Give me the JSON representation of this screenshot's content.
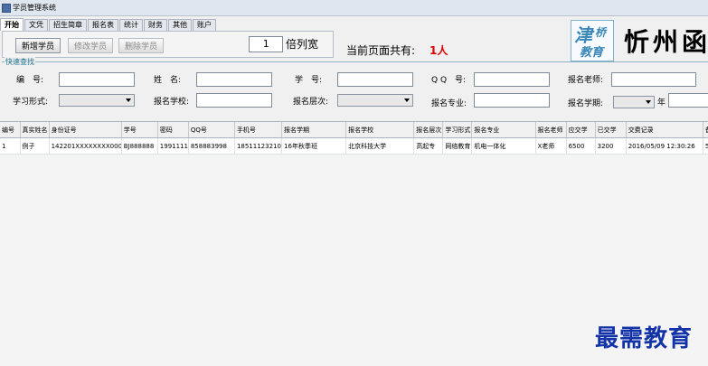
{
  "window": {
    "title": "学员管理系统",
    "icon": "app-icon"
  },
  "tabs": [
    "开始",
    "文凭",
    "招生简章",
    "报名表",
    "统计",
    "财务",
    "其他",
    "账户"
  ],
  "toolbar": {
    "add_label": "新增学员",
    "edit_label": "修改学员",
    "delete_label": "删除学员",
    "multiplier_value": "1",
    "multiplier_label": "倍列宽",
    "count_label": "当前页面共有:",
    "count_value": "1人"
  },
  "logo": {
    "line1": "津",
    "line2": "桥",
    "line3": "教育"
  },
  "brand_text": "忻州函",
  "search": {
    "title": "快速查找",
    "id_label": "编　号:",
    "name_label": "姓　名:",
    "student_no_label": "学　号:",
    "qq_label": "Q Q　号:",
    "teacher_label": "报名老师:",
    "mode_label": "学习形式:",
    "school_label": "报名学校:",
    "level_label": "报名层次:",
    "major_label": "报名专业:",
    "term_label": "报名学期:",
    "year_label": "年"
  },
  "table": {
    "columns": [
      "编号",
      "真实姓名",
      "身份证号",
      "学号",
      "密码",
      "QQ号",
      "手机号",
      "报名学期",
      "报名学校",
      "报名层次",
      "学习形式",
      "报名专业",
      "报名老师",
      "应交学",
      "已交学",
      "交费记录",
      "备"
    ],
    "rows": [
      [
        "1",
        "例子",
        "142201XXXXXXXX0000",
        "BJ888888",
        "1991111",
        "858883998",
        "18511123210",
        "16年秋季班",
        "北京科技大学",
        "高起专",
        "网络教育",
        "机电一体化",
        "X老师",
        "6500",
        "3200",
        "2016/05/09 12:30:26",
        "5"
      ]
    ]
  },
  "watermark": "最需教育"
}
